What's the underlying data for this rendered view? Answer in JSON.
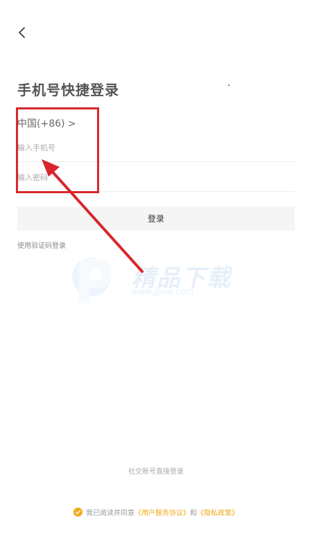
{
  "header": {
    "back_icon": "chevron-left-icon"
  },
  "page": {
    "title": "手机号快捷登录"
  },
  "form": {
    "country_code": "中国(+86) >",
    "phone_placeholder": "输入手机号",
    "phone_value": "",
    "password_placeholder": "输入密码",
    "password_value": "",
    "login_label": "登录",
    "sms_login_label": "使用验证码登录"
  },
  "watermark": {
    "title": "精品下载",
    "url": "www.jpxw.com"
  },
  "footer": {
    "social_login_label": "社交账号直接登录",
    "agreement_prefix": "我已阅读并同意",
    "user_agreement": "《用户服务协议》",
    "conjunction": "和",
    "privacy_policy": "《隐私政策》",
    "check_color": "#f3a81c"
  },
  "annotation": {
    "color": "#d9262c"
  }
}
